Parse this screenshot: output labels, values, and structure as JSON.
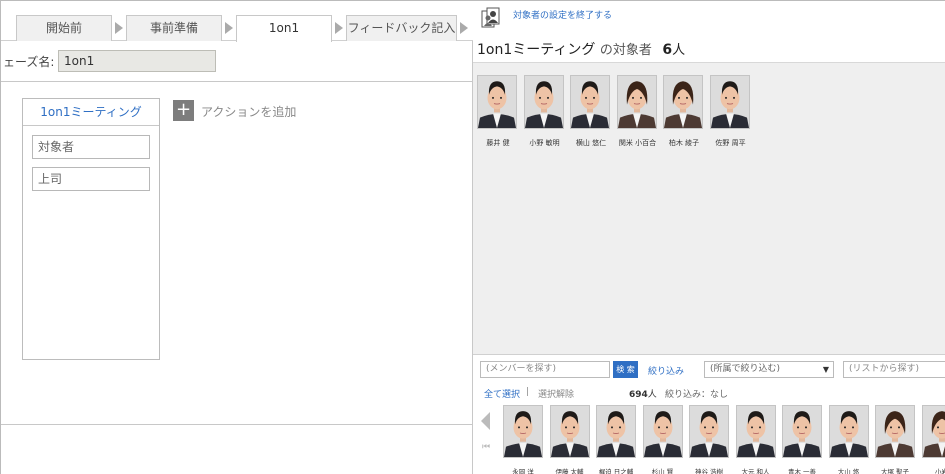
{
  "steps": [
    {
      "label": "開始前"
    },
    {
      "label": "事前準備"
    },
    {
      "label": "1on1"
    },
    {
      "label": "フィードバック記入"
    }
  ],
  "phase": {
    "label": "ェーズ名:",
    "value": "1on1"
  },
  "action_card": {
    "title": "1on1ミーティング",
    "fields": [
      "対象者",
      "上司"
    ]
  },
  "add_action_label": "アクションを追加",
  "right": {
    "end_link": "対象者の設定を終了する",
    "heading": {
      "title": "1on1ミーティング",
      "sub": "の対象者",
      "count": "6",
      "unit": "人"
    },
    "targets": [
      {
        "name": "藤井 健",
        "gender": "m"
      },
      {
        "name": "小野 敏明",
        "gender": "m"
      },
      {
        "name": "横山 悠仁",
        "gender": "m"
      },
      {
        "name": "関米 小百合",
        "gender": "f"
      },
      {
        "name": "柏木 綾子",
        "gender": "f"
      },
      {
        "name": "佐野 周平",
        "gender": "m"
      }
    ],
    "search": {
      "member_placeholder": "(メンバーを探す)",
      "search_button": "検 索",
      "filter_link": "絞り込み",
      "dept_placeholder": "(所属で絞り込む)",
      "list_placeholder": "(リストから探す)"
    },
    "members_header": {
      "select_all": "全て選択",
      "separator": "|",
      "deselect": "選択解除",
      "total_count": "694",
      "total_unit": "人",
      "filter_status": "絞り込み：なし"
    },
    "members": [
      {
        "name": "永岡 洋",
        "gender": "m"
      },
      {
        "name": "伊藤 太輔",
        "gender": "m"
      },
      {
        "name": "梶迫 日之輔",
        "gender": "m"
      },
      {
        "name": "杉山 賢",
        "gender": "m"
      },
      {
        "name": "神谷 浩樹",
        "gender": "m"
      },
      {
        "name": "大元 和人",
        "gender": "m"
      },
      {
        "name": "青木 一善",
        "gender": "m"
      },
      {
        "name": "大山 悠",
        "gender": "m"
      },
      {
        "name": "大塚 聖子",
        "gender": "f"
      },
      {
        "name": "小岩",
        "gender": "f"
      }
    ]
  },
  "colors": {
    "accent": "#2f6fc4",
    "tab_bg": "#f0f0f0",
    "panel_bg": "#efefef"
  }
}
